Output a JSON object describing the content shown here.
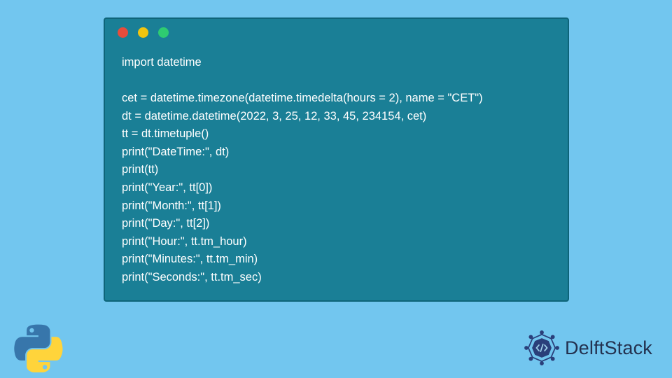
{
  "code": {
    "lines": [
      "import datetime",
      "",
      "cet = datetime.timezone(datetime.timedelta(hours = 2), name = \"CET\")",
      "dt = datetime.datetime(2022, 3, 25, 12, 33, 45, 234154, cet)",
      "tt = dt.timetuple()",
      "print(\"DateTime:\", dt)",
      "print(tt)",
      "print(\"Year:\", tt[0])",
      "print(\"Month:\", tt[1])",
      "print(\"Day:\", tt[2])",
      "print(\"Hour:\", tt.tm_hour)",
      "print(\"Minutes:\", tt.tm_min)",
      "print(\"Seconds:\", tt.tm_sec)"
    ]
  },
  "brand": {
    "name": "DelftStack"
  }
}
